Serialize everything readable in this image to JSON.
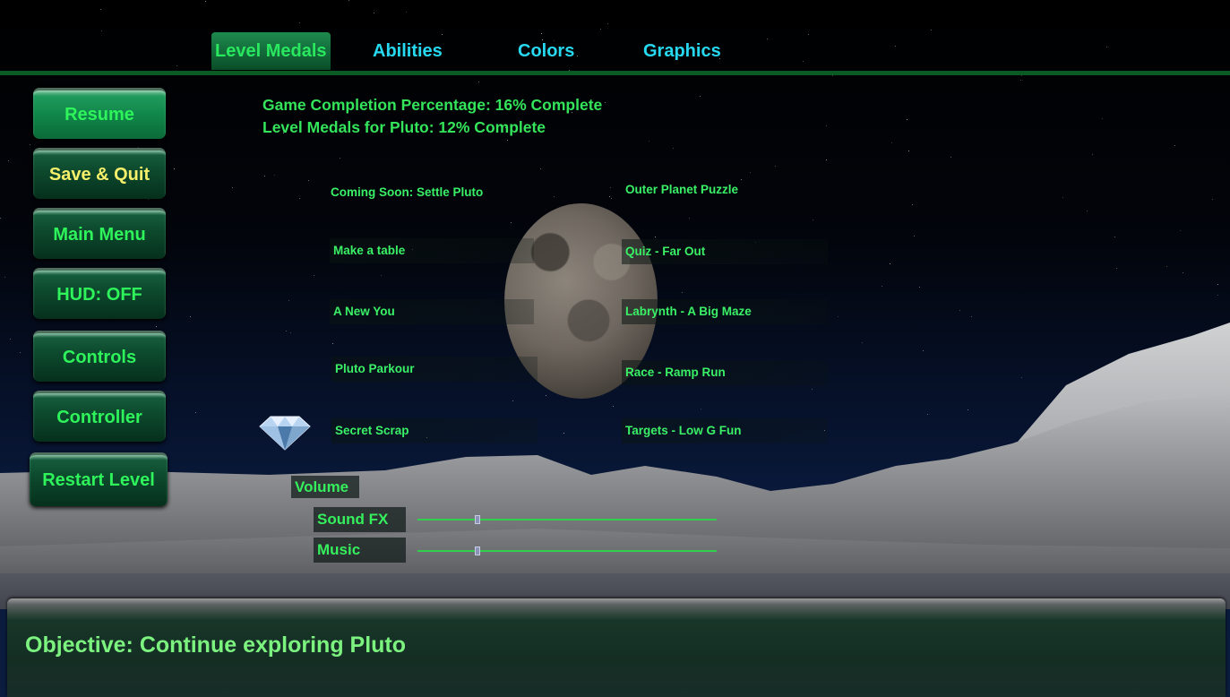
{
  "tabs": [
    {
      "label": "Level Medals",
      "active": true
    },
    {
      "label": "Abilities",
      "active": false
    },
    {
      "label": "Colors",
      "active": false
    },
    {
      "label": "Graphics",
      "active": false
    }
  ],
  "menu": {
    "resume": "Resume",
    "save_quit": "Save & Quit",
    "main_menu": "Main Menu",
    "hud": "HUD: OFF",
    "controls": "Controls",
    "controller": "Controller",
    "restart": "Restart Level"
  },
  "stats": {
    "completion": "Game Completion Percentage: 16% Complete",
    "medals": "Level Medals for Pluto: 12% Complete"
  },
  "levels": {
    "left": [
      "Coming Soon: Settle Pluto",
      "Make a table",
      "A New You",
      "Pluto Parkour",
      "Secret Scrap"
    ],
    "right": [
      "Outer Planet Puzzle",
      "Quiz - Far Out",
      "Labrynth - A Big Maze",
      "Race - Ramp Run",
      "Targets - Low G Fun"
    ]
  },
  "volume": {
    "title": "Volume",
    "sound_fx": {
      "label": "Sound FX",
      "level": 0.2
    },
    "music": {
      "label": "Music",
      "level": 0.2
    }
  },
  "objective": "Objective: Continue exploring Pluto",
  "colors": {
    "accent_green": "#2ef35b",
    "tab_cyan": "#26d9f0",
    "button_yellow": "#f5ef6a"
  }
}
